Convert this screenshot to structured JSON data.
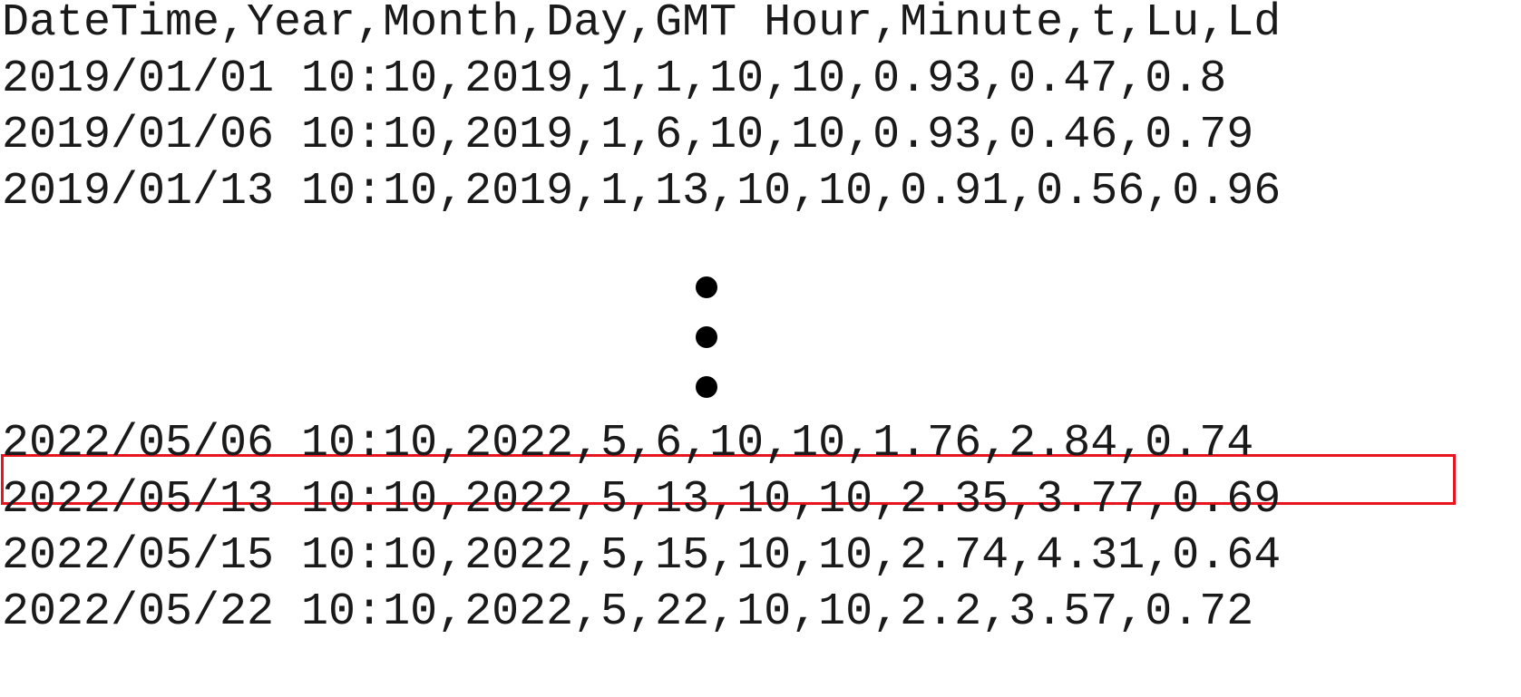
{
  "header": {
    "text": "DateTime,Year,Month,Day,GMT Hour,Minute,t,Lu,Ld"
  },
  "rows_top": [
    "2019/01/01 10:10,2019,1,1,10,10,0.93,0.47,0.8",
    "2019/01/06 10:10,2019,1,6,10,10,0.93,0.46,0.79",
    "2019/01/13 10:10,2019,1,13,10,10,0.91,0.56,0.96"
  ],
  "ellipsis": {
    "icon": "vertical-ellipsis-icon"
  },
  "rows_bottom": [
    "2022/05/06 10:10,2022,5,6,10,10,1.76,2.84,0.74",
    "2022/05/13 10:10,2022,5,13,10,10,2.35,3.77,0.69",
    "2022/05/15 10:10,2022,5,15,10,10,2.74,4.31,0.64",
    "2022/05/22 10:10,2022,5,22,10,10,2.2,3.57,0.72"
  ],
  "highlight": {
    "row": "2022/05/06 10:10,2022,5,6,10,10,1.76,2.84,0.74",
    "color": "#e8141e"
  }
}
